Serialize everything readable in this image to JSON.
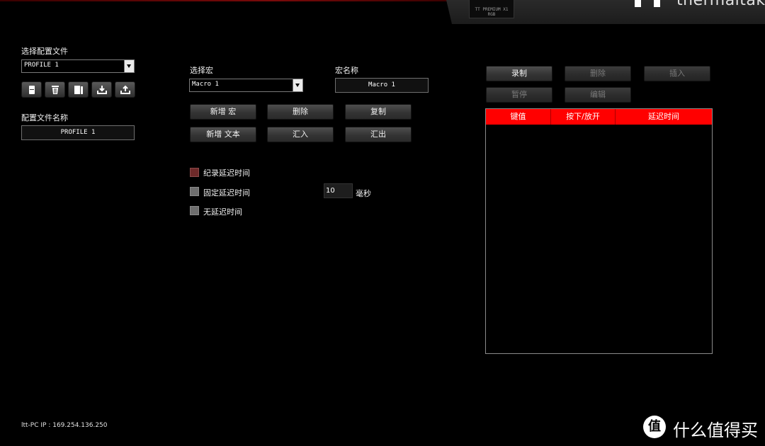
{
  "header": {
    "device_badge_line1": "TT PREMIUM X1",
    "device_badge_line2": "RGB",
    "brand": "thermaltake"
  },
  "profile": {
    "select_label": "选择配置文件",
    "selected": "PROFILE 1",
    "name_label": "配置文件名称",
    "name_value": "PROFILE 1",
    "icon_buttons": [
      "new-icon",
      "trash-icon",
      "copy-icon",
      "import-icon",
      "export-icon"
    ]
  },
  "macro": {
    "select_label": "选择宏",
    "selected": "Macro 1",
    "name_label": "宏名称",
    "name_value": "Macro 1",
    "buttons": {
      "new_macro": "新增 宏",
      "delete": "删除",
      "copy": "复制",
      "new_text": "新增 文本",
      "import": "汇入",
      "export": "汇出"
    },
    "delay_options": [
      {
        "label": "纪录延迟时间",
        "checked": true
      },
      {
        "label": "固定延迟时间",
        "checked": false
      },
      {
        "label": "无延迟时间",
        "checked": false
      }
    ],
    "fixed_delay_value": "10",
    "fixed_delay_unit": "毫秒"
  },
  "recorder": {
    "buttons": {
      "record": "录制",
      "delete": "删除",
      "insert": "插入",
      "pause": "暂停",
      "edit": "编辑"
    },
    "columns": [
      "键值",
      "按下/放开",
      "延迟时间"
    ],
    "rows": []
  },
  "footer": {
    "ip_text": "ltt-PC IP : 169.254.136.250"
  },
  "watermark": {
    "text": "什么值得买"
  },
  "colors": {
    "accent": "#ff0000",
    "background": "#000000"
  }
}
